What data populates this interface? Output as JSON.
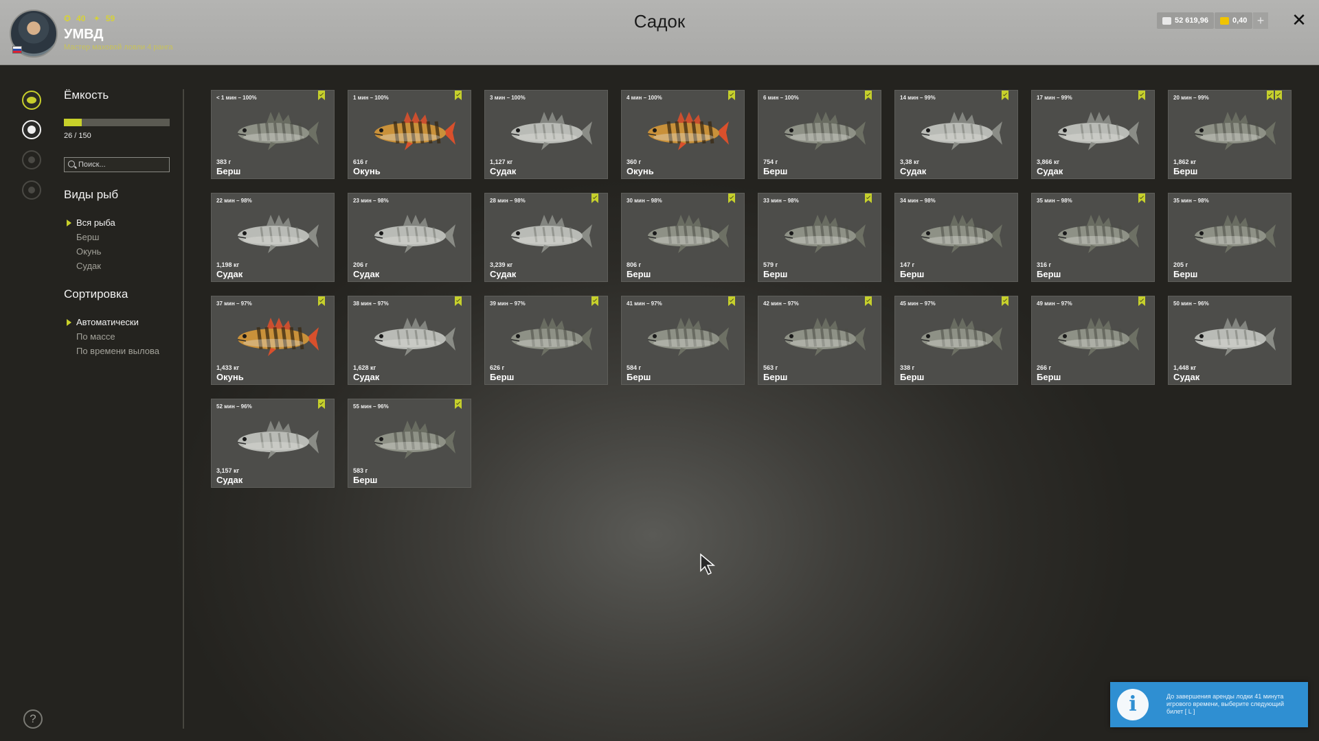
{
  "header": {
    "title": "Садок",
    "player": {
      "name": "УМВД",
      "rank": "Мастер маховой ловли 4 ранга",
      "stat_level": "40",
      "stat_stars": "59"
    },
    "currency": {
      "silver": "52 619,96",
      "gold": "0,40",
      "add_label": "+"
    },
    "close_label": "✕"
  },
  "sidebar": {
    "capacity": {
      "title": "Ёмкость",
      "text": "26 / 150",
      "fill_fraction": 0.173
    },
    "search": {
      "placeholder": "Поиск..."
    },
    "species_filter": {
      "title": "Виды рыб",
      "items": [
        "Вся рыба",
        "Берш",
        "Окунь",
        "Судак"
      ],
      "selected": "Вся рыба"
    },
    "sort": {
      "title": "Сортировка",
      "items": [
        "Автоматически",
        "По массе",
        "По времени вылова"
      ],
      "selected": "Автоматически"
    },
    "nav_icons": [
      "keepnet-icon",
      "fish-icon",
      "fire-icon",
      "trophy-icon"
    ],
    "help_label": "?"
  },
  "fish_cards": [
    {
      "meta": "< 1 мин – 100%",
      "weight": "383 г",
      "species": "Берш",
      "marks": 1
    },
    {
      "meta": "1 мин – 100%",
      "weight": "616 г",
      "species": "Окунь",
      "marks": 1
    },
    {
      "meta": "3 мин – 100%",
      "weight": "1,127 кг",
      "species": "Судак",
      "marks": 0
    },
    {
      "meta": "4 мин – 100%",
      "weight": "360 г",
      "species": "Окунь",
      "marks": 1
    },
    {
      "meta": "6 мин – 100%",
      "weight": "754 г",
      "species": "Берш",
      "marks": 1
    },
    {
      "meta": "14 мин – 99%",
      "weight": "3,38 кг",
      "species": "Судак",
      "marks": 1
    },
    {
      "meta": "17 мин – 99%",
      "weight": "3,866 кг",
      "species": "Судак",
      "marks": 1
    },
    {
      "meta": "20 мин – 99%",
      "weight": "1,862 кг",
      "species": "Берш",
      "marks": 2
    },
    {
      "meta": "22 мин – 98%",
      "weight": "1,198 кг",
      "species": "Судак",
      "marks": 0
    },
    {
      "meta": "23 мин – 98%",
      "weight": "206 г",
      "species": "Судак",
      "marks": 0
    },
    {
      "meta": "28 мин – 98%",
      "weight": "3,239 кг",
      "species": "Судак",
      "marks": 1
    },
    {
      "meta": "30 мин – 98%",
      "weight": "806 г",
      "species": "Берш",
      "marks": 1
    },
    {
      "meta": "33 мин – 98%",
      "weight": "579 г",
      "species": "Берш",
      "marks": 1
    },
    {
      "meta": "34 мин – 98%",
      "weight": "147 г",
      "species": "Берш",
      "marks": 0
    },
    {
      "meta": "35 мин – 98%",
      "weight": "316 г",
      "species": "Берш",
      "marks": 1
    },
    {
      "meta": "35 мин – 98%",
      "weight": "205 г",
      "species": "Берш",
      "marks": 0
    },
    {
      "meta": "37 мин – 97%",
      "weight": "1,433 кг",
      "species": "Окунь",
      "marks": 1
    },
    {
      "meta": "38 мин – 97%",
      "weight": "1,628 кг",
      "species": "Судак",
      "marks": 1
    },
    {
      "meta": "39 мин – 97%",
      "weight": "626 г",
      "species": "Берш",
      "marks": 1
    },
    {
      "meta": "41 мин – 97%",
      "weight": "584 г",
      "species": "Берш",
      "marks": 1
    },
    {
      "meta": "42 мин – 97%",
      "weight": "563 г",
      "species": "Берш",
      "marks": 1
    },
    {
      "meta": "45 мин – 97%",
      "weight": "338 г",
      "species": "Берш",
      "marks": 1
    },
    {
      "meta": "49 мин – 97%",
      "weight": "266 г",
      "species": "Берш",
      "marks": 1
    },
    {
      "meta": "50 мин – 96%",
      "weight": "1,448 кг",
      "species": "Судак",
      "marks": 0
    },
    {
      "meta": "52 мин – 96%",
      "weight": "3,157 кг",
      "species": "Судак",
      "marks": 1
    },
    {
      "meta": "55 мин – 96%",
      "weight": "583 г",
      "species": "Берш",
      "marks": 1
    }
  ],
  "notification": {
    "icon": "info-icon",
    "text": "До завершения аренды лодки 41 минута игрового времени, выберите следующий билет [ L ]"
  },
  "colors": {
    "accent": "#c8d02a",
    "header_bg": "#b0b0ae",
    "card_bg": "#4d4d4a",
    "notice_bg": "#2f8fd2",
    "perch_body": "#c9913a",
    "zander_body": "#b9bbb6",
    "bersh_body": "#8e9186"
  }
}
